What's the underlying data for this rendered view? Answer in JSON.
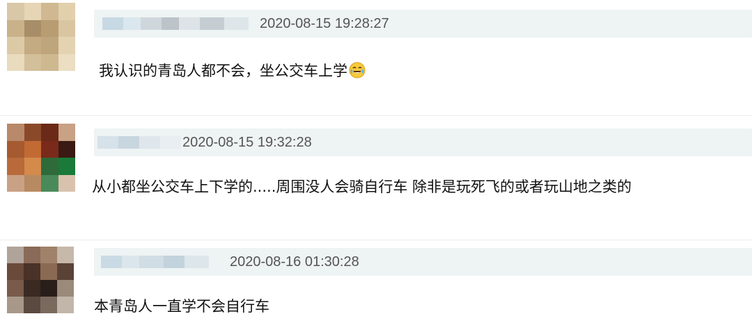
{
  "comments": [
    {
      "timestamp": "2020-08-15 19:28:27",
      "text": "我认识的青岛人都不会，坐公交车上学",
      "emoji": "laughing-tears-emoji",
      "avatar_palette": "beige"
    },
    {
      "timestamp": "2020-08-15 19:32:28",
      "text": "从小都坐公交车上下学的.....周围没人会骑自行车 除非是玩死飞的或者玩山地之类的",
      "avatar_palette": "red-green"
    },
    {
      "timestamp": "2020-08-16 01:30:28",
      "text": "本青岛人一直学不会自行车",
      "avatar_palette": "dark-brown"
    }
  ],
  "colors": {
    "meta_bar": "#eef3f3",
    "timestamp": "#555555",
    "text": "#111111"
  }
}
